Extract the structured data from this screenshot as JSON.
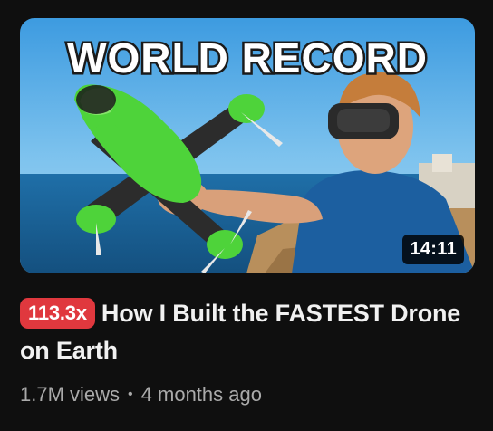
{
  "thumbnail": {
    "overlay_text": "WORLD RECORD",
    "duration": "14:11"
  },
  "video": {
    "multiplier_badge": "113.3x",
    "title": "How I Built the FASTEST Drone on Earth",
    "views": "1.7M views",
    "age": "4 months ago"
  },
  "colors": {
    "background": "#0f0f0f",
    "badge": "#e0383e",
    "title": "#f1f1f1",
    "meta": "#aaaaaa"
  }
}
